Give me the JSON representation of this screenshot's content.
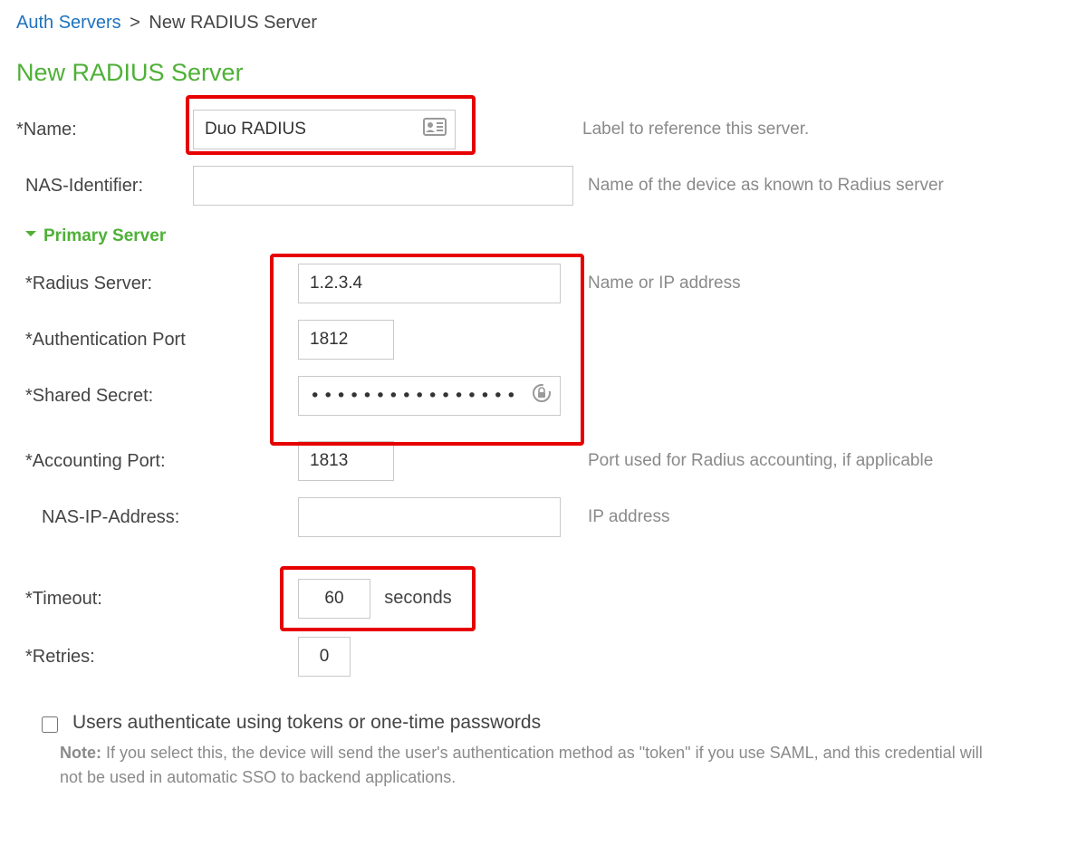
{
  "breadcrumb": {
    "link": "Auth Servers",
    "current": "New RADIUS Server"
  },
  "page_title": "New RADIUS Server",
  "fields": {
    "name": {
      "label": "*Name:",
      "value": "Duo RADIUS",
      "hint": "Label to reference this server."
    },
    "nas_identifier": {
      "label": "NAS-Identifier:",
      "value": "",
      "hint": "Name of the device as known to Radius server"
    }
  },
  "section_primary": "Primary Server",
  "primary": {
    "radius_server": {
      "label": "*Radius Server:",
      "value": "1.2.3.4",
      "hint": "Name or IP address"
    },
    "auth_port": {
      "label": "*Authentication Port",
      "value": "1812"
    },
    "shared_secret": {
      "label": "*Shared Secret:",
      "value": "••••••••••••••••"
    },
    "accounting_port": {
      "label": "*Accounting Port:",
      "value": "1813",
      "hint": "Port used for Radius accounting, if applicable"
    },
    "nas_ip": {
      "label": "NAS-IP-Address:",
      "value": "",
      "hint": "IP address"
    },
    "timeout": {
      "label": "*Timeout:",
      "value": "60",
      "unit": "seconds"
    },
    "retries": {
      "label": "*Retries:",
      "value": "0"
    }
  },
  "checkbox": {
    "label": "Users authenticate using tokens or one-time passwords",
    "note_prefix": "Note:",
    "note": " If you select this, the device will send the user's authentication method as \"token\" if you use SAML, and this credential will not be used in automatic SSO to backend applications."
  }
}
